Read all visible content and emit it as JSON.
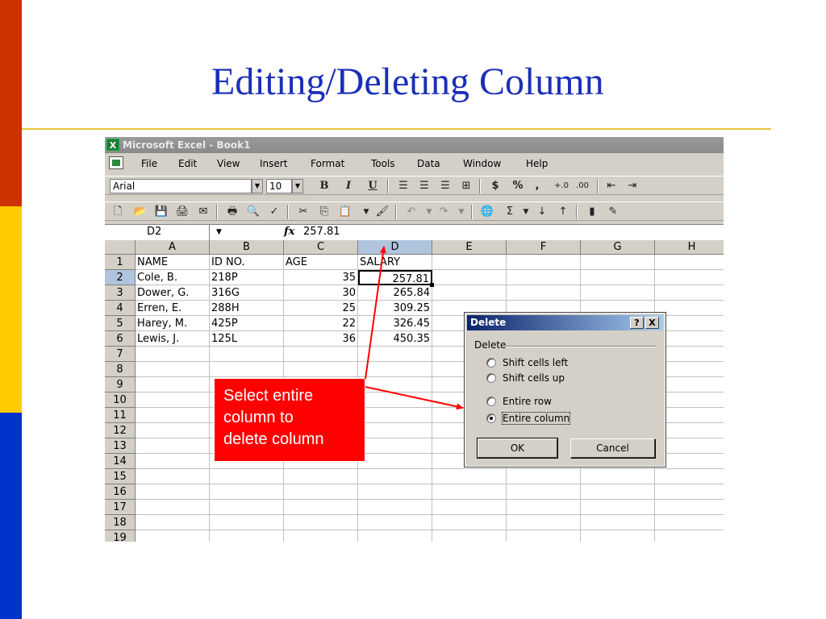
{
  "slide": {
    "title": "Editing/Deleting Column"
  },
  "window": {
    "title": "Microsoft Excel - Book1"
  },
  "menu": [
    {
      "label": "File",
      "hot": "F"
    },
    {
      "label": "Edit",
      "hot": "E"
    },
    {
      "label": "View",
      "hot": "V"
    },
    {
      "label": "Insert",
      "hot": "I"
    },
    {
      "label": "Format",
      "hot": "o"
    },
    {
      "label": "Tools",
      "hot": "T"
    },
    {
      "label": "Data",
      "hot": "D"
    },
    {
      "label": "Window",
      "hot": "W"
    },
    {
      "label": "Help",
      "hot": "H"
    }
  ],
  "formatting_toolbar": {
    "font": "Arial",
    "size": "10",
    "bold": "B",
    "italic": "I",
    "underline": "U",
    "currency": "$",
    "percent": "%",
    "comma": ","
  },
  "formula_bar": {
    "name_box": "D2",
    "fx": "fx",
    "value": "257.81"
  },
  "sheet": {
    "columns": [
      "A",
      "B",
      "C",
      "D",
      "E",
      "F",
      "G",
      "H"
    ],
    "selected_column": "D",
    "rows": [
      "1",
      "2",
      "3",
      "4",
      "5",
      "6",
      "7",
      "8",
      "9",
      "10",
      "11",
      "12",
      "13",
      "14",
      "15",
      "16",
      "17",
      "18",
      "19"
    ],
    "data": [
      [
        "NAME",
        "ID NO.",
        "AGE",
        "SALARY"
      ],
      [
        "Cole, B.",
        "218P",
        "35",
        "257.81"
      ],
      [
        "Dower, G.",
        "316G",
        "30",
        "265.84"
      ],
      [
        "Erren, E.",
        "288H",
        "25",
        "309.25"
      ],
      [
        "Harey, M.",
        "425P",
        "22",
        "326.45"
      ],
      [
        "Lewis, J.",
        "125L",
        "36",
        "450.35"
      ]
    ]
  },
  "dialog": {
    "title": "Delete",
    "help_btn": "?",
    "close_btn": "X",
    "group": "Delete",
    "options": [
      "Shift cells left",
      "Shift cells up",
      "Entire row",
      "Entire column"
    ],
    "selected": "Entire column",
    "ok": "OK",
    "cancel": "Cancel"
  },
  "callout": {
    "text_line1": "Select entire",
    "text_line2": "column to",
    "text_line3": "delete column"
  },
  "colors": {
    "title_blue": "#1a2fb8",
    "callout_red": "#ff0000",
    "selection_blue": "#b0c4de"
  }
}
